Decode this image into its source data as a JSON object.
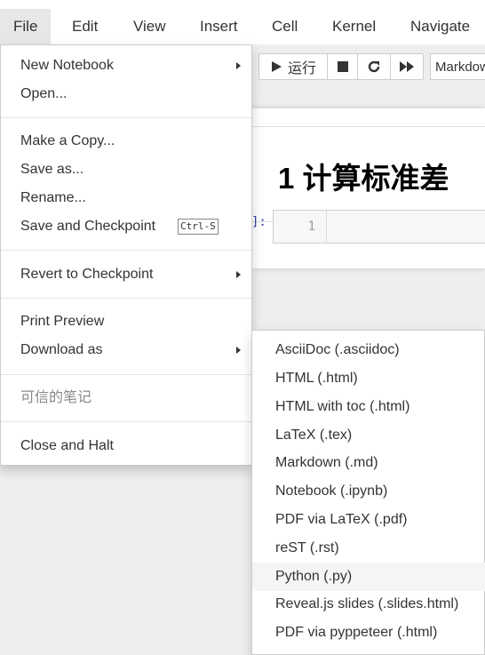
{
  "menubar": {
    "items": [
      {
        "label": "File"
      },
      {
        "label": "Edit"
      },
      {
        "label": "View"
      },
      {
        "label": "Insert"
      },
      {
        "label": "Cell"
      },
      {
        "label": "Kernel"
      },
      {
        "label": "Navigate"
      }
    ]
  },
  "toolbar": {
    "run_label": "运行",
    "cell_type_value": "Markdown"
  },
  "notebook": {
    "heading": "1  计算标准差",
    "prompt": "]:",
    "line_number": "1"
  },
  "file_menu": {
    "new_notebook": "New Notebook",
    "open": "Open...",
    "make_copy": "Make a Copy...",
    "save_as": "Save as...",
    "rename": "Rename...",
    "save_checkpoint": "Save and Checkpoint",
    "save_checkpoint_shortcut": "Ctrl-S",
    "revert_checkpoint": "Revert to Checkpoint",
    "print_preview": "Print Preview",
    "download_as": "Download as",
    "trusted": "可信的笔记",
    "close_halt": "Close and Halt"
  },
  "download_submenu": {
    "items": [
      {
        "label": "AsciiDoc (.asciidoc)"
      },
      {
        "label": "HTML (.html)"
      },
      {
        "label": "HTML with toc (.html)"
      },
      {
        "label": "LaTeX (.tex)"
      },
      {
        "label": "Markdown (.md)"
      },
      {
        "label": "Notebook (.ipynb)"
      },
      {
        "label": "PDF via LaTeX (.pdf)"
      },
      {
        "label": "reST (.rst)"
      },
      {
        "label": "Python (.py)"
      },
      {
        "label": "Reveal.js slides (.slides.html)"
      },
      {
        "label": "PDF via pyppeteer (.html)"
      }
    ],
    "highlighted": "Python (.py)"
  }
}
